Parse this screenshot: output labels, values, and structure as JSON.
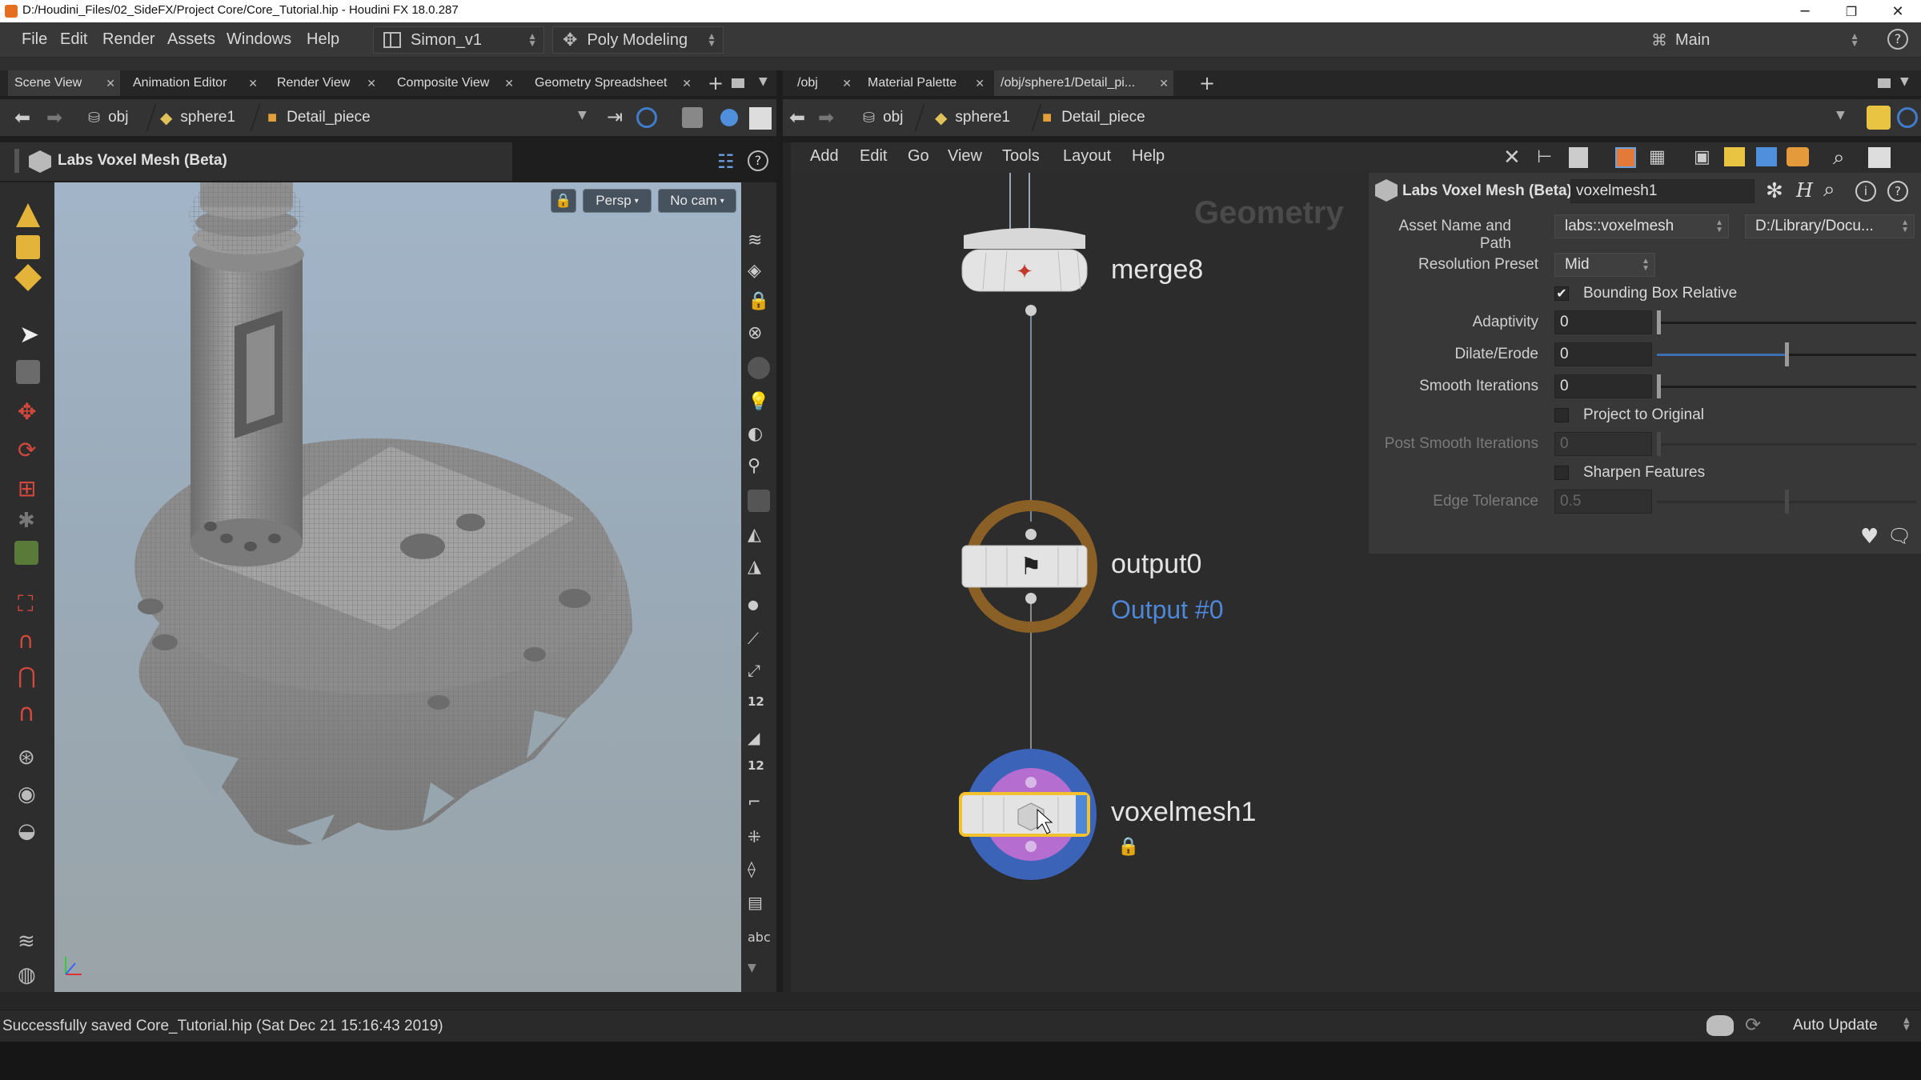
{
  "window": {
    "title": "D:/Houdini_Files/02_SideFX/Project Core/Core_Tutorial.hip - Houdini FX 18.0.287",
    "minimize": "─",
    "maximize": "❐",
    "close": "✕"
  },
  "menubar": {
    "items": [
      "File",
      "Edit",
      "Render",
      "Assets",
      "Windows",
      "Help"
    ],
    "desktop": "Simon_v1",
    "shelf_set": "Poly Modeling",
    "right_desktop": "Main",
    "help_glyph": "?"
  },
  "left_tabs": [
    "Scene View",
    "Animation Editor",
    "Render View",
    "Composite View",
    "Geometry Spreadsheet"
  ],
  "right_tabs": [
    "/obj",
    "Material Palette",
    "/obj/sphere1/Detail_pi..."
  ],
  "tab_close": "✕",
  "tab_add": "+",
  "left_path": {
    "crumbs": [
      "obj",
      "sphere1",
      "Detail_piece"
    ]
  },
  "right_path": {
    "crumbs": [
      "obj",
      "sphere1",
      "Detail_piece"
    ]
  },
  "viewer": {
    "node_title": "Labs Voxel Mesh (Beta)",
    "persp": "Persp",
    "cam": "No cam",
    "help": "?",
    "abc": "abc"
  },
  "network_menu": [
    "Add",
    "Edit",
    "Go",
    "View",
    "Tools",
    "Layout",
    "Help"
  ],
  "network": {
    "context_label": "Geometry",
    "nodes": [
      {
        "name": "merge8",
        "sub": ""
      },
      {
        "name": "output0",
        "sub": "Output #0"
      },
      {
        "name": "voxelmesh1",
        "sub": ""
      }
    ]
  },
  "params": {
    "header_type": "Labs Voxel Mesh (Beta)",
    "node_name": "voxelmesh1",
    "asset_name_label": "Asset Name and Path",
    "asset_name": "labs::voxelmesh",
    "asset_path": "D:/Library/Docu...",
    "resolution_preset_label": "Resolution Preset",
    "resolution_preset": "Mid",
    "bounding_box_relative": "Bounding Box Relative",
    "adaptivity_label": "Adaptivity",
    "adaptivity": "0",
    "dilate_label": "Dilate/Erode",
    "dilate": "0",
    "smooth_label": "Smooth Iterations",
    "smooth": "0",
    "project_label": "Project to Original",
    "post_smooth_label": "Post Smooth Iterations",
    "post_smooth": "0",
    "sharpen_label": "Sharpen Features",
    "edge_tol_label": "Edge Tolerance",
    "edge_tol": "0.5",
    "bounding_box_checked": true,
    "project_checked": false,
    "sharpen_checked": false
  },
  "status": {
    "message": "Successfully saved Core_Tutorial.hip (Sat Dec 21 15:16:43 2019)",
    "auto_update": "Auto Update"
  },
  "colors": {
    "accent_blue": "#4d87d6",
    "output_ring": "#8a6026",
    "voxel_ring": "#3b63b8",
    "voxel_inner": "#b56ed0",
    "selection": "#f2c12e"
  }
}
